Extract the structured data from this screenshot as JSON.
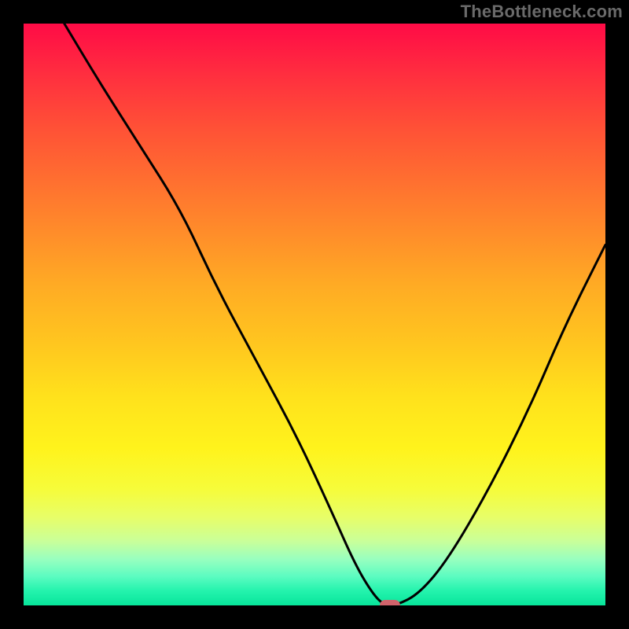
{
  "watermark": "TheBottleneck.com",
  "chart_data": {
    "type": "line",
    "title": "",
    "xlabel": "",
    "ylabel": "",
    "xlim": [
      0,
      100
    ],
    "ylim": [
      0,
      100
    ],
    "grid": false,
    "legend": false,
    "series": [
      {
        "name": "bottleneck-curve",
        "x": [
          7,
          13,
          20,
          27,
          33,
          40,
          47,
          53,
          57,
          60,
          62,
          64,
          68,
          73,
          80,
          87,
          93,
          100
        ],
        "y": [
          100,
          90,
          79,
          68,
          55,
          42,
          29,
          16,
          7,
          2,
          0,
          0,
          2,
          8,
          20,
          34,
          48,
          62
        ]
      }
    ],
    "marker": {
      "x": 63,
      "y": 0,
      "color": "#d1636b"
    },
    "background_gradient": {
      "top": "#ff0b46",
      "middle": "#ffe11c",
      "bottom": "#07e59a"
    }
  }
}
